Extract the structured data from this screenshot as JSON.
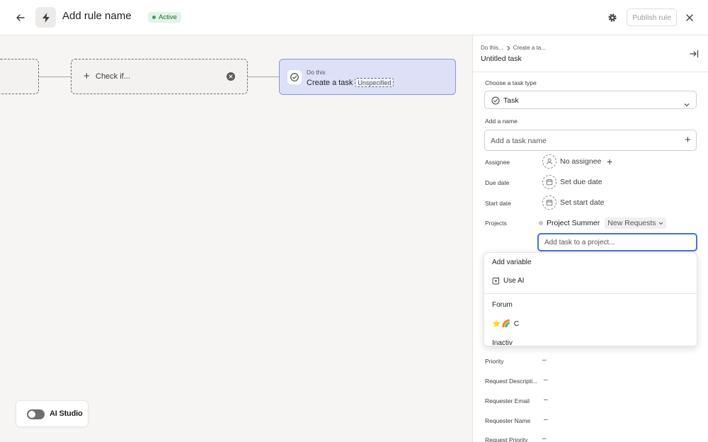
{
  "header": {
    "rule_name": "Add rule name",
    "status": "Active",
    "publish_label": "Publish rule"
  },
  "canvas": {
    "check_label": "Check if...",
    "action": {
      "kicker": "Do this",
      "title": "Create a task",
      "badge": "Unspecified"
    },
    "ai_studio_label": "AI Studio"
  },
  "panel": {
    "breadcrumb": [
      "Do this...",
      "Create a ta..."
    ],
    "title": "Untitled task",
    "task_type_label": "Choose a task type",
    "task_type_value": "Task",
    "name_label": "Add a name",
    "name_placeholder": "Add a task name",
    "fields": {
      "assignee": {
        "label": "Assignee",
        "value": "No assignee"
      },
      "due_date": {
        "label": "Due date",
        "value": "Set due date"
      },
      "start_date": {
        "label": "Start date",
        "value": "Set start date"
      },
      "projects": {
        "label": "Projects",
        "project": "Project Summer",
        "section": "New Requests"
      }
    },
    "project_input_placeholder": "Add task to a project...",
    "dropdown": {
      "add_variable": "Add variable",
      "use_ai": "Use AI",
      "items": [
        "Forum",
        "C",
        "Inactiv"
      ]
    },
    "custom_fields": [
      {
        "label": "Priority",
        "value": "–"
      },
      {
        "label": "Request Descripti...",
        "value": "–"
      },
      {
        "label": "Requester Email",
        "value": "–"
      },
      {
        "label": "Requester Name",
        "value": "–"
      },
      {
        "label": "Request Priority",
        "value": "–"
      }
    ]
  },
  "colors": {
    "accent": "#4573d2",
    "action_node_bg": "#dde0f7",
    "active_badge_bg": "#e3f3e7"
  }
}
